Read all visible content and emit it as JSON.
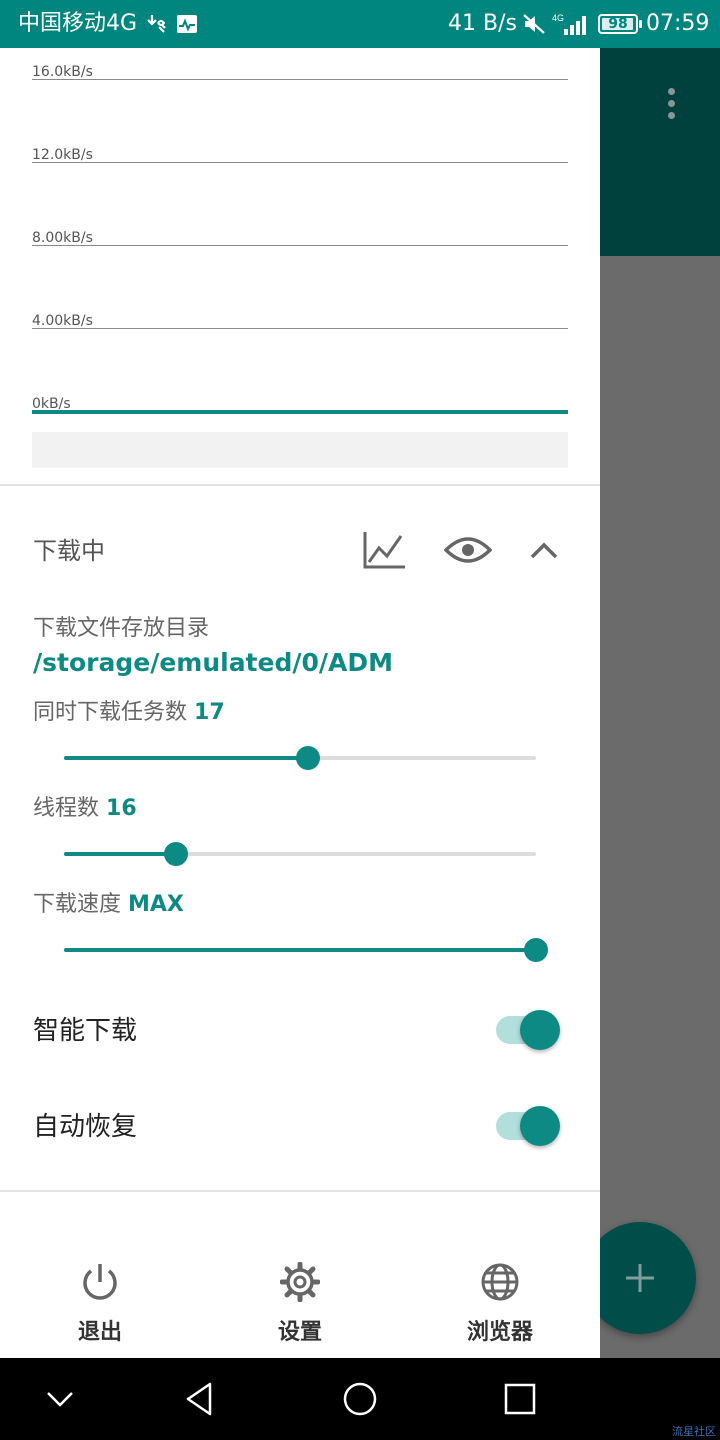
{
  "status_bar": {
    "carrier": "中国移动4G",
    "net_speed": "41 B/s",
    "network_type": "4G",
    "battery": "98",
    "time": "07:59",
    "icons": [
      "usb-download-icon",
      "activity-monitor-icon",
      "mute-icon",
      "signal-icon",
      "battery-icon"
    ]
  },
  "chart": {
    "tick_labels": [
      "16.0kB/s",
      "12.0kB/s",
      "8.00kB/s",
      "4.00kB/s",
      "0kB/s"
    ]
  },
  "chart_data": {
    "type": "line",
    "title": "",
    "xlabel": "",
    "ylabel": "",
    "y_ticks": [
      "16.0kB/s",
      "12.0kB/s",
      "8.00kB/s",
      "4.00kB/s",
      "0kB/s"
    ],
    "ylim": [
      0,
      16
    ],
    "series": [
      {
        "values": [
          0,
          0
        ]
      }
    ],
    "grid": true,
    "color": "#0e8a84"
  },
  "section": {
    "title": "下载中",
    "icons": [
      "line-chart-icon",
      "eye-icon",
      "chevron-up-icon"
    ]
  },
  "settings": {
    "dir_label": "下载文件存放目录",
    "dir_value": "/storage/emulated/0/ADM",
    "concurrent_label": "同时下载任务数",
    "concurrent_value": "17",
    "concurrent_fraction": 0.517,
    "threads_label": "线程数",
    "threads_value": "16",
    "threads_fraction": 0.237,
    "speed_label": "下载速度",
    "speed_value": "MAX",
    "speed_fraction": 1.0
  },
  "toggles": {
    "smart_download_label": "智能下载",
    "smart_download_on": true,
    "auto_resume_label": "自动恢复",
    "auto_resume_on": true
  },
  "bottom_nav": {
    "exit_label": "退出",
    "settings_label": "设置",
    "browser_label": "浏览器"
  },
  "watermark": "流星社区",
  "colors": {
    "accent": "#0e8a84",
    "status_bar": "#00857f",
    "toolbar_dim": "#00403d"
  }
}
